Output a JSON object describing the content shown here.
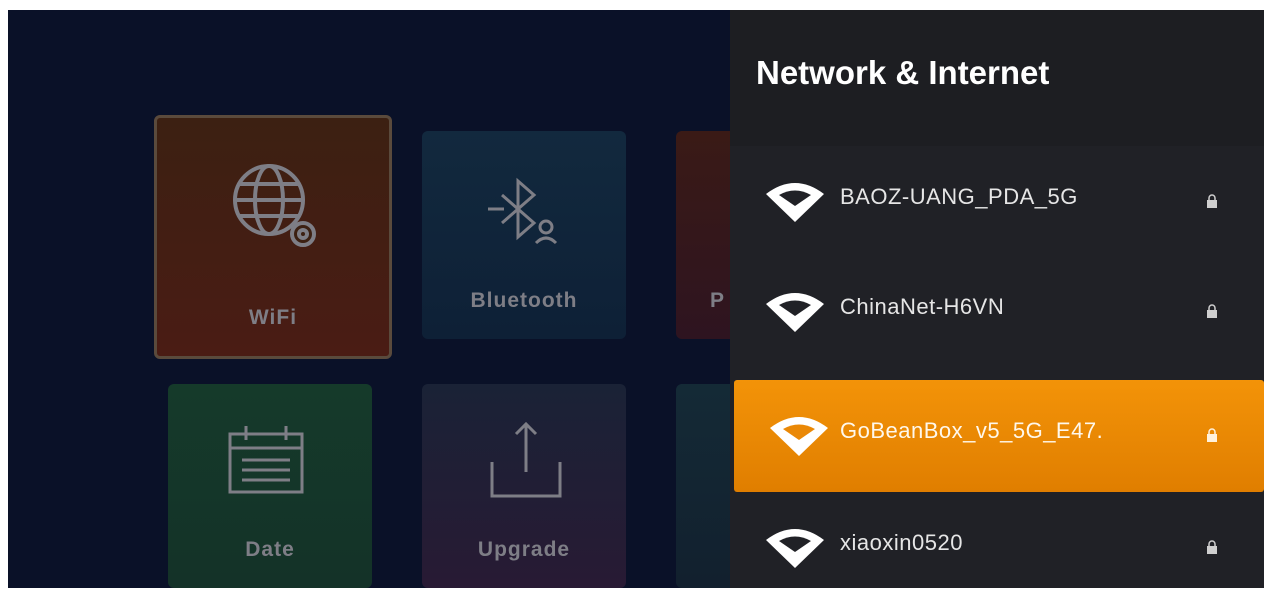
{
  "tiles": [
    {
      "label": "WiFi"
    },
    {
      "label": "Bluetooth"
    },
    {
      "label": "P"
    },
    {
      "label": "Date"
    },
    {
      "label": "Upgrade"
    }
  ],
  "panel": {
    "title": "Network & Internet",
    "networks": [
      {
        "ssid": "BAOZ-UANG_PDA_5G",
        "secured": true,
        "selected": false
      },
      {
        "ssid": "ChinaNet-H6VN",
        "secured": true,
        "selected": false
      },
      {
        "ssid": "GoBeanBox_v5_5G_E47.",
        "secured": true,
        "selected": true
      },
      {
        "ssid": "xiaoxin0520",
        "secured": true,
        "selected": false
      }
    ]
  },
  "colors": {
    "background": "#0a1128",
    "panel": "#202126",
    "accent": "#f39308"
  },
  "icons": [
    "globe-icon",
    "bluetooth-icon",
    "calendar-icon",
    "upload-icon",
    "wifi-signal-icon",
    "lock-icon"
  ]
}
